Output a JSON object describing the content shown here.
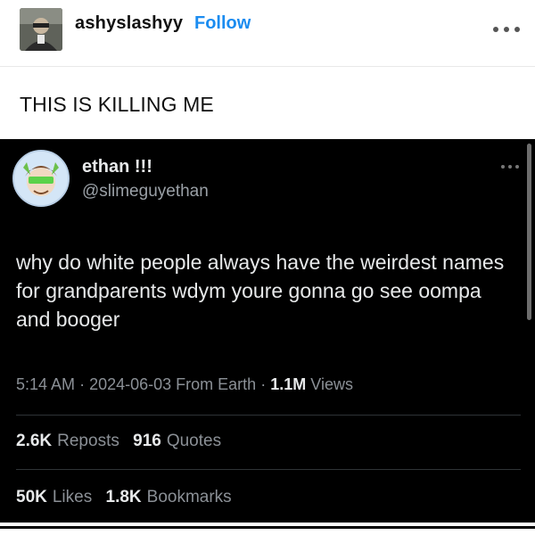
{
  "tumblr_post": {
    "username": "ashyslashyy",
    "follow_label": "Follow",
    "caption": "THIS IS KILLING ME",
    "more_icon": "ellipsis-icon"
  },
  "tweet": {
    "display_name": "ethan !!!",
    "handle": "@slimeguyethan",
    "text": "why do white people always have the weirdest names for grandparents wdym youre gonna go see oompa and booger",
    "time": "5:14 AM",
    "date": "2024-06-03",
    "source": "From Earth",
    "views_count": "1.1M",
    "views_label": "Views",
    "separator": "·",
    "reposts_count": "2.6K",
    "reposts_label": "Reposts",
    "quotes_count": "916",
    "quotes_label": "Quotes",
    "likes_count": "50K",
    "likes_label": "Likes",
    "bookmarks_count": "1.8K",
    "bookmarks_label": "Bookmarks",
    "more_icon": "ellipsis-icon"
  },
  "colors": {
    "follow_blue": "#1b8cf0",
    "tweet_bg": "#000000",
    "tweet_text": "#e7e9ea",
    "tweet_muted": "#8b9096"
  }
}
